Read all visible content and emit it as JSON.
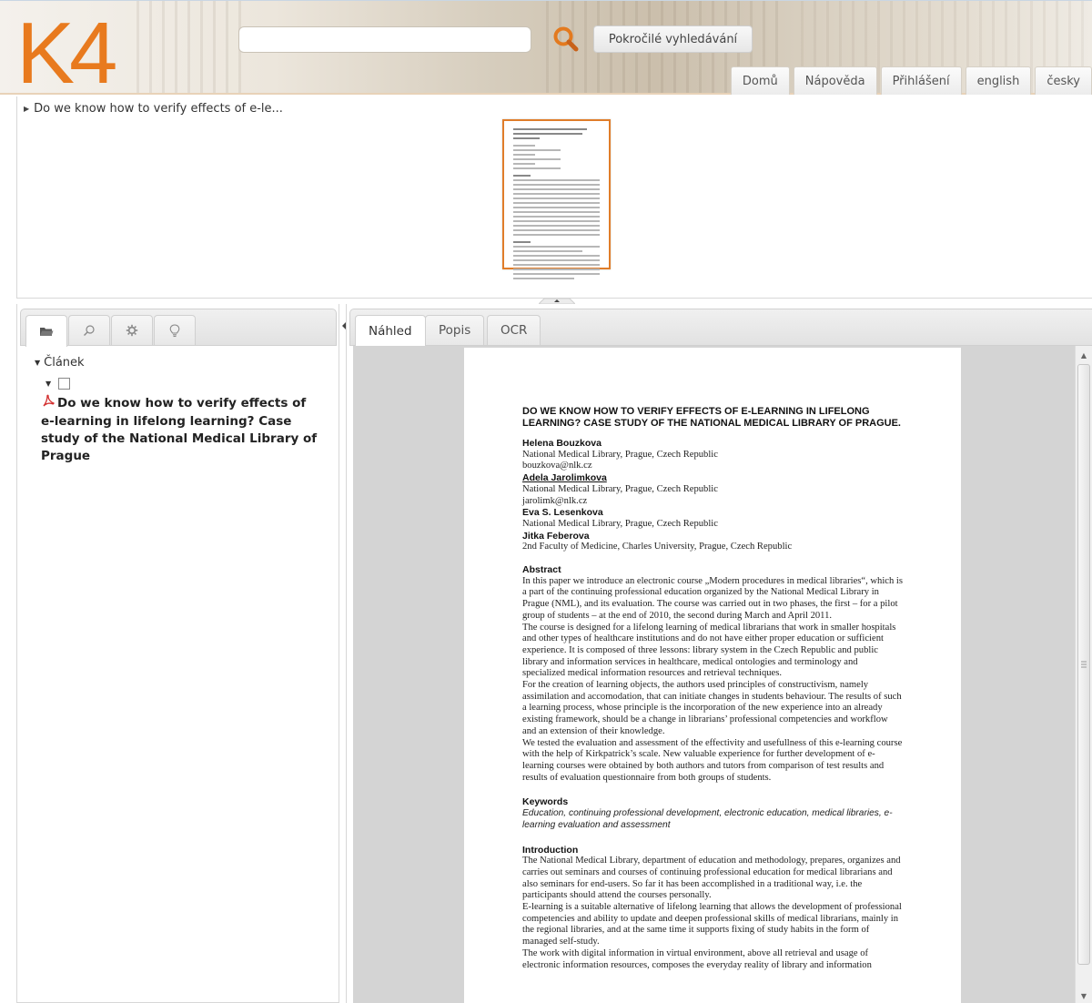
{
  "header": {
    "logo_text": "K4",
    "search_placeholder": "",
    "advanced_search_label": "Pokročilé vyhledávání",
    "nav": [
      "Domů",
      "Nápověda",
      "Přihlášení",
      "english",
      "česky"
    ],
    "accent_color": "#e87a1e"
  },
  "breadcrumb": {
    "label": "Do we know how to verify effects of e-le..."
  },
  "left_panel": {
    "tab_icons": [
      "folder-icon",
      "search-icon",
      "gear-icon",
      "lightbulb-icon"
    ],
    "tree": {
      "root_label": "Článek",
      "item_title": "Do we know how to verify effects of e-learning in lifelong learning? Case study of the National Medical Library of Prague"
    }
  },
  "right_panel": {
    "tabs": [
      "Náhled",
      "Popis",
      "OCR"
    ],
    "document": {
      "title": "DO WE KNOW HOW TO VERIFY EFFECTS OF E-LEARNING IN LIFELONG LEARNING? CASE STUDY OF THE NATIONAL MEDICAL LIBRARY OF PRAGUE.",
      "authors": [
        {
          "name": "Helena Bouzkova",
          "affiliation": "National Medical Library, Prague, Czech Republic",
          "email": "bouzkova@nlk.cz"
        },
        {
          "name": "Adela Jarolimkova",
          "affiliation": "National Medical Library, Prague, Czech Republic",
          "email": "jarolimk@nlk.cz"
        },
        {
          "name": "Eva S. Lesenkova",
          "affiliation": "National Medical Library, Prague, Czech Republic",
          "email": ""
        },
        {
          "name": "Jitka Feberova",
          "affiliation": "2nd Faculty of Medicine, Charles University, Prague, Czech Republic",
          "email": ""
        }
      ],
      "abstract_heading": "Abstract",
      "abstract_p1": "In this paper we introduce an electronic course „Modern procedures in medical libraries“, which is a part of the continuing professional education organized by the National Medical Library in Prague (NML), and its evaluation. The course was carried out in two phases, the first – for a pilot group of students – at the end of 2010, the second during March and April 2011.",
      "abstract_p2": "The course is designed for a lifelong learning of medical librarians that work in smaller hospitals and other types of healthcare institutions and do not have either proper education or sufficient experience. It is composed of three lessons: library system in the Czech Republic and public library and information services in healthcare, medical ontologies and terminology and specialized medical information resources and retrieval techniques.",
      "abstract_p3": "For the creation of learning objects, the authors used principles of constructivism, namely assimilation and accomodation, that can initiate changes in students behaviour. The results of such a learning process, whose principle is the incorporation of the new experience into an already existing framework, should be a change in librarians’ professional competencies and workflow and an extension of their knowledge.",
      "abstract_p4": "We tested the evaluation and assessment of the effectivity and usefullness of this e-learning course with the help of Kirkpatrick’s scale. New valuable experience for further development of e-learning courses were obtained by both authors and tutors from comparison of test results and results of evaluation questionnaire from both groups of students.",
      "keywords_heading": "Keywords",
      "keywords": "Education, continuing professional development, electronic education, medical libraries, e-learning evaluation and assessment",
      "intro_heading": "Introduction",
      "intro_p1": "The National Medical Library, department of education and methodology, prepares, organizes and carries out seminars and courses of continuing professional education for medical librarians and also seminars for end-users. So far it has been accomplished in a traditional way, i.e. the participants should attend the courses personally.",
      "intro_p2": "E-learning is a suitable alternative of lifelong learning that allows the development of professional competencies and ability to update and deepen professional skills of medical librarians, mainly in the regional libraries, and at the same time it supports fixing of study habits in the form of managed self-study.",
      "intro_p3": "The work with digital information in virtual environment, above all retrieval and usage of electronic information resources, composes the everyday reality of library and information"
    }
  }
}
